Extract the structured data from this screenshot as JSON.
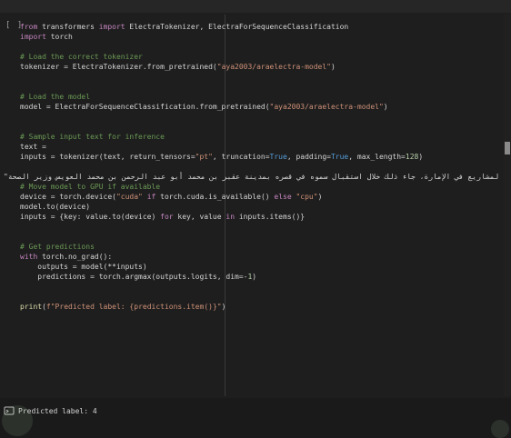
{
  "cell": {
    "run_indicator": "[ ]",
    "lines": [
      [
        [
          "kw",
          "from"
        ],
        [
          "t",
          " transformers "
        ],
        [
          "kw",
          "import"
        ],
        [
          "t",
          " ElectraTokenizer, ElectraForSequenceClassification"
        ]
      ],
      [
        [
          "kw",
          "import"
        ],
        [
          "t",
          " torch"
        ]
      ],
      [],
      [
        [
          "cm",
          "# Load the correct tokenizer"
        ]
      ],
      [
        [
          "t",
          "tokenizer = ElectraTokenizer.from_pretrained("
        ],
        [
          "st",
          "\"aya2003/araelectra-model\""
        ],
        [
          "t",
          ")"
        ]
      ],
      [],
      [],
      [
        [
          "cm",
          "# Load the model"
        ]
      ],
      [
        [
          "t",
          "model = ElectraForSequenceClassification.from_pretrained("
        ],
        [
          "st",
          "\"aya2003/araelectra-model\""
        ],
        [
          "t",
          ")"
        ]
      ],
      [],
      [],
      [
        [
          "cm",
          "# Sample input text for inference"
        ]
      ],
      [
        [
          "t",
          "text = "
        ]
      ],
      [
        [
          "t",
          "inputs = tokenizer(text, return_tensors="
        ],
        [
          "st",
          "\"pt\""
        ],
        [
          "t",
          ", truncation="
        ],
        [
          "cn",
          "True"
        ],
        [
          "t",
          ", padding="
        ],
        [
          "cn",
          "True"
        ],
        [
          "t",
          ", max_length="
        ],
        [
          "num",
          "128"
        ],
        [
          "t",
          ")"
        ]
      ],
      [],
      [],
      [
        [
          "cm",
          "# Move model to GPU if available"
        ]
      ],
      [
        [
          "t",
          "device = torch.device("
        ],
        [
          "st",
          "\"cuda\""
        ],
        [
          "t",
          " "
        ],
        [
          "kw",
          "if"
        ],
        [
          "t",
          " torch.cuda.is_available() "
        ],
        [
          "kw",
          "else"
        ],
        [
          "t",
          " "
        ],
        [
          "st",
          "\"cpu\""
        ],
        [
          "t",
          ")"
        ]
      ],
      [
        [
          "t",
          "model.to(device)"
        ]
      ],
      [
        [
          "t",
          "inputs = {key: value.to(device) "
        ],
        [
          "kw",
          "for"
        ],
        [
          "t",
          " key, value "
        ],
        [
          "kw",
          "in"
        ],
        [
          "t",
          " inputs.items()}"
        ]
      ],
      [],
      [],
      [
        [
          "cm",
          "# Get predictions"
        ]
      ],
      [
        [
          "kw",
          "with"
        ],
        [
          "t",
          " torch.no_grad():"
        ]
      ],
      [
        [
          "t",
          "    outputs = model(**inputs)"
        ]
      ],
      [
        [
          "t",
          "    predictions = torch.argmax(outputs.logits, dim=-"
        ],
        [
          "num",
          "1"
        ],
        [
          "t",
          ")"
        ]
      ],
      [],
      [],
      [
        [
          "bi",
          "print"
        ],
        [
          "t",
          "("
        ],
        [
          "st",
          "f\"Predicted label: {predictions.item()}\""
        ],
        [
          "t",
          ")"
        ]
      ]
    ],
    "arabic_string": "\"تعمق العشقيلية والعالمية، والتي تتضمن تنفيذ عدد من المشاريع في الإمارة، جاء ذلك خلال استقبال سموه في قصره بمدينة عقبر بن محمد أبو عبد الرحمن بن محمد العويس وزير الصحة\""
  },
  "output": {
    "icon": "output-toggle-icon",
    "text": "Predicted label: 4"
  },
  "colors": {
    "background": "#1e1e1e",
    "keyword": "#c586c0",
    "comment": "#6a9955",
    "string": "#ce9178",
    "builtin": "#dcdcaa",
    "number": "#b5cea8",
    "constant": "#569cd6"
  }
}
